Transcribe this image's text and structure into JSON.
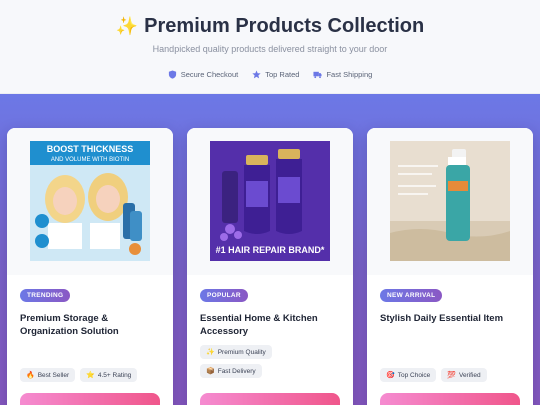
{
  "header": {
    "sparkle_icon": "sparkles-icon",
    "title": "Premium Products Collection",
    "subtitle": "Handpicked quality products delivered straight to your door",
    "badges": [
      {
        "icon": "shield-icon",
        "label": "Secure Checkout"
      },
      {
        "icon": "star-icon",
        "label": "Top Rated"
      },
      {
        "icon": "truck-icon",
        "label": "Fast Shipping"
      }
    ]
  },
  "colors": {
    "accent": "#6c78e6",
    "gradient_end": "#8558bf",
    "cta_start": "#f58bd0",
    "cta_end": "#f0568b"
  },
  "products": [
    {
      "tag": "TRENDING",
      "name": "Premium Storage & Organization Solution",
      "image_text": [
        "BOOST THICKNESS",
        "AND VOLUME WITH BIOTIN"
      ],
      "features": [
        {
          "icon": "🔥",
          "label": "Best Seller"
        },
        {
          "icon": "⭐",
          "label": "4.5+ Rating"
        }
      ]
    },
    {
      "tag": "POPULAR",
      "name": "Essential Home & Kitchen Accessory",
      "image_text": [
        "#1 HAIR REPAIR BRAND*"
      ],
      "features": [
        {
          "icon": "✨",
          "label": "Premium Quality"
        },
        {
          "icon": "📦",
          "label": "Fast Delivery"
        }
      ]
    },
    {
      "tag": "NEW ARRIVAL",
      "name": "Stylish Daily Essential Item",
      "image_text": [],
      "features": [
        {
          "icon": "🎯",
          "label": "Top Choice"
        },
        {
          "icon": "💯",
          "label": "Verified"
        }
      ]
    }
  ]
}
